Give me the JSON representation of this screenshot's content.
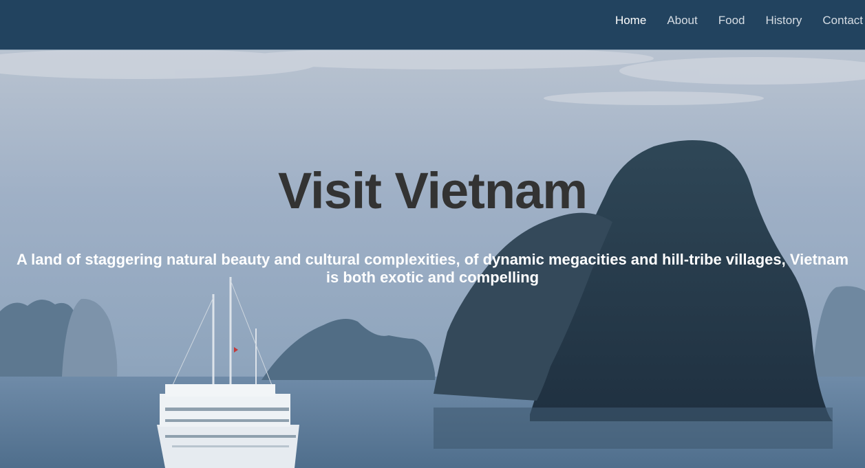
{
  "nav": {
    "items": [
      {
        "label": "Home",
        "active": true
      },
      {
        "label": "About",
        "active": false
      },
      {
        "label": "Food",
        "active": false
      },
      {
        "label": "History",
        "active": false
      },
      {
        "label": "Contact",
        "active": false
      }
    ]
  },
  "hero": {
    "title": "Visit Vietnam",
    "subtitle": "A land of staggering natural beauty and cultural complexities, of dynamic megacities and hill-tribe villages, Vietnam is both exotic and compelling"
  },
  "colors": {
    "navbar": "#22435f",
    "title": "#333333",
    "subtitle": "#ffffff",
    "sky": "#9fb0c6",
    "water": "#4f6e8c",
    "karst": "#2a3c4a"
  }
}
